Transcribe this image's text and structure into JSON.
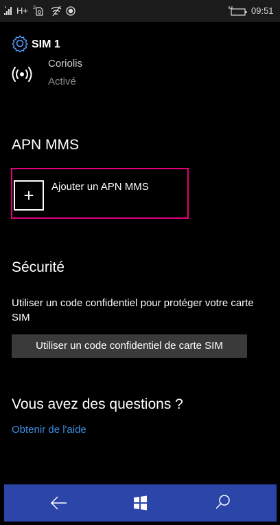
{
  "status_bar": {
    "network_label": "H+",
    "time": "09:51"
  },
  "header": {
    "title": "SIM 1",
    "icon": "gear-icon"
  },
  "network": {
    "icon": "broadcast-icon",
    "name": "Coriolis",
    "status": "Activé"
  },
  "apn_section": {
    "title": "APN MMS",
    "add_label": "Ajouter un APN MMS",
    "plus_glyph": "+"
  },
  "security_section": {
    "title": "Sécurité",
    "description": "Utiliser un code confidentiel pour protéger votre carte SIM",
    "button_label": "Utiliser un code confidentiel de carte SIM"
  },
  "help_section": {
    "title": "Vous avez des questions ?",
    "link_label": "Obtenir de l'aide"
  },
  "nav_bar": {
    "items": [
      "back-arrow-icon",
      "windows-logo-icon",
      "search-icon"
    ]
  },
  "colors": {
    "accent_border": "#e3007a",
    "link": "#3b8fe6",
    "nav_bar": "#2b45a8"
  }
}
